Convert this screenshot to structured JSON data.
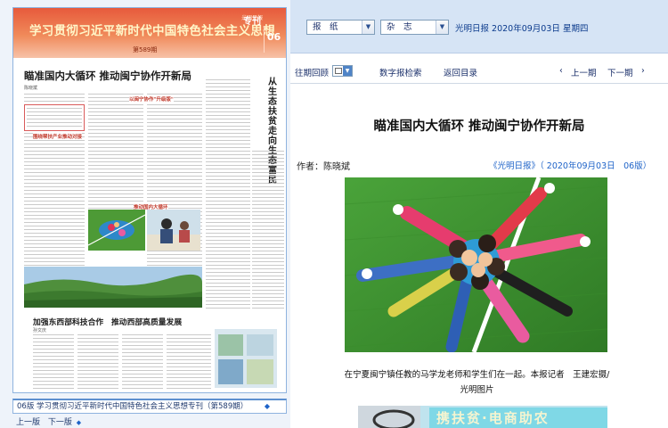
{
  "newspaper_page": {
    "banner_title": "学习贯彻习近平新时代中国特色社会主义思想",
    "banner_tag": "专刊",
    "banner_logo": "光明日報",
    "page_number": "06",
    "issue": "第589期",
    "lead_headline": "瞄准国内大循环 推动闽宁协作开新局",
    "lead_byline": "陈晓斌",
    "side_headline": "从生态扶贫走向生态富民",
    "subheads": [
      "以闽宁协作\"升级版\"",
      "围绕帮扶产业推动对接",
      "推动国内大循环"
    ],
    "second_headline": "加强东西部科技合作　推动西部高质量发展",
    "second_byline": "孙文庆"
  },
  "page_caption": "06版 学习贯彻习近平新时代中国特色社会主义思想专刊（第589期）",
  "page_nav": {
    "prev": "上一版",
    "next": "下一版"
  },
  "toolbar": {
    "select_paper": "报　纸",
    "select_magazine": "杂　志",
    "paper_name": "光明日报",
    "date": "2020年09月03日",
    "weekday": "星期四"
  },
  "nav": {
    "past_review": "往期回顾",
    "digital_search": "数字报检索",
    "back_to_contents": "返回目录",
    "prev_issue": "上一期",
    "next_issue": "下一期",
    "prev_arrow": "‹",
    "next_arrow": "›"
  },
  "article": {
    "title": "瞄准国内大循环 推动闽宁协作开新局",
    "author_label": "作者：",
    "author": "陈晓斌",
    "source": "《光明日报》（ 2020年09月03日　06版）",
    "photo_caption": "在宁夏闽宁镇任教的马学龙老师和学生们在一起。本报记者　王建宏摄/光明图片",
    "next_photo_text": "携扶贫·电商助农"
  },
  "colors": {
    "banner_red": "#e75a3c",
    "link_blue": "#1e63c8",
    "toolbar_bg": "#d6e4f5",
    "grass_green": "#3e8a2c"
  }
}
